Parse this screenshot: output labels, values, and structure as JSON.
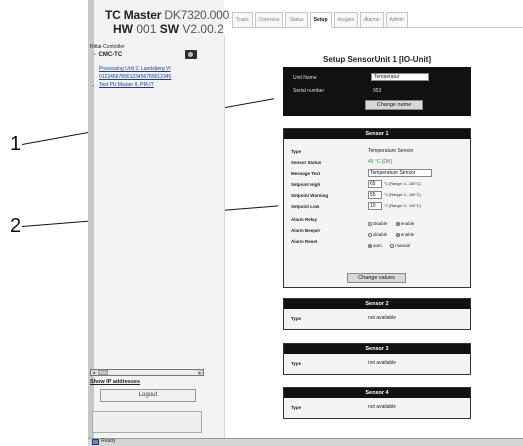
{
  "callouts": [
    {
      "number": "1"
    },
    {
      "number": "2"
    }
  ],
  "header": {
    "product": "TC Master",
    "model": "DK7320.000",
    "hw_label": "HW",
    "hw_value": "001",
    "sw_label": "SW",
    "sw_value": "V2.00.2"
  },
  "tabs": [
    "Traps",
    "Overview",
    "Status",
    "Setup",
    "Images",
    "Alarms",
    "Admin"
  ],
  "tree": {
    "root": "Rittal-Controller",
    "node_expander": "−",
    "node": "CMC-TC",
    "links": [
      "Processing Unit 2, Landsberg VI",
      "01234567890123456789012345",
      "Test PU Master II, PM-IT"
    ],
    "selected_marker": "→"
  },
  "icons": {
    "camera": "camera-icon",
    "selected": "selected-arrow-icon",
    "scroll_left": "scroll-left-icon",
    "scroll_right": "scroll-right-icon",
    "status": "status-icon"
  },
  "sidebar": {
    "show_ip": "Show IP addresses",
    "logout": "Logout",
    "scroll_left_glyph": "◂",
    "scroll_right_glyph": "▸"
  },
  "main": {
    "title": "Setup SensorUnit 1 [IO-Unit]",
    "unit": {
      "name_label": "Unit Name",
      "name_value": "Temperatur",
      "serial_label": "Serial number",
      "serial_value": "953",
      "change_name": "Change name"
    },
    "sensor1": {
      "header": "Sensor 1",
      "type_label": "Type",
      "type_value": "Temperature Sensor",
      "status_label": "Sensor Status",
      "status_value": "45 °C [OK]",
      "message_label": "Message Text",
      "message_value": "Temperature Sensor",
      "setpoint_high_label": "Setpoint High",
      "setpoint_high_value": "65",
      "setpoint_warning_label": "Setpoint Warning",
      "setpoint_warning_value": "55",
      "setpoint_low_label": "Setpoint Low",
      "setpoint_low_value": "10",
      "unit_range": "°C [Range: 0...100°C]",
      "alarm_relay_label": "Alarm Relay",
      "alarm_beeper_label": "Alarm Beeper",
      "alarm_reset_label": "Alarm Reset",
      "disable": "disable",
      "enable": "enable",
      "auto": "auto",
      "manual": "manual",
      "change_values": "Change values"
    },
    "other_sensors": [
      {
        "header": "Sensor 2",
        "type_label": "Type",
        "type_value": "not available"
      },
      {
        "header": "Sensor 3",
        "type_label": "Type",
        "type_value": "not available"
      },
      {
        "header": "Sensor 4",
        "type_label": "Type",
        "type_value": "not available"
      }
    ]
  },
  "statusbar": {
    "text": "Ready"
  }
}
